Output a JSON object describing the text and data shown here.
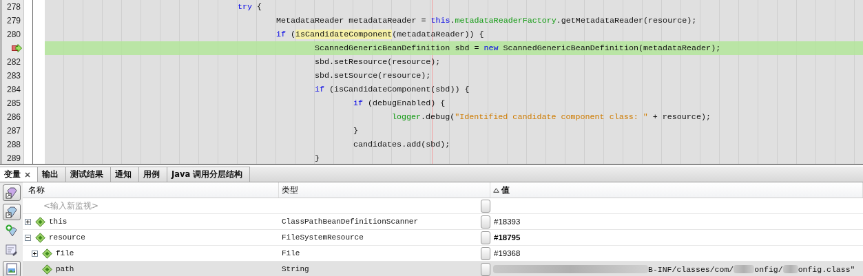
{
  "editor": {
    "lines": [
      {
        "number": "278",
        "current": false,
        "tokens": [
          {
            "kind": "keyword",
            "text": "try"
          },
          {
            "kind": "plain",
            "text": " {"
          }
        ],
        "children": [
          {
            "number": "279",
            "current": false,
            "tokens": [
              {
                "kind": "plain",
                "text": "MetadataReader metadataReader = "
              },
              {
                "kind": "keyword",
                "text": "this"
              },
              {
                "kind": "plain",
                "text": "."
              },
              {
                "kind": "field",
                "text": "metadataReaderFactory"
              },
              {
                "kind": "plain",
                "text": ".getMetadataReader(resource);"
              }
            ]
          },
          {
            "number": "280",
            "current": false,
            "tokens": [
              {
                "kind": "keyword",
                "text": "if"
              },
              {
                "kind": "plain",
                "text": " ("
              },
              {
                "kind": "mark",
                "text": "isCandidateComponent"
              },
              {
                "kind": "plain",
                "text": "(metadataReader)) {"
              }
            ],
            "children": [
              {
                "current": true,
                "tokens": [
                  {
                    "kind": "plain",
                    "text": "ScannedGenericBeanDefinition sbd = "
                  },
                  {
                    "kind": "keyword",
                    "text": "new"
                  },
                  {
                    "kind": "plain",
                    "text": " ScannedGenericBeanDefinition(metadataReader);"
                  }
                ]
              },
              {
                "number": "282",
                "current": false,
                "tokens": [
                  {
                    "kind": "plain",
                    "text": "sbd.setResource(resource);"
                  }
                ]
              },
              {
                "number": "283",
                "current": false,
                "tokens": [
                  {
                    "kind": "plain",
                    "text": "sbd.setSource(resource);"
                  }
                ]
              },
              {
                "number": "284",
                "current": false,
                "tokens": [
                  {
                    "kind": "keyword",
                    "text": "if"
                  },
                  {
                    "kind": "plain",
                    "text": " (isCandidateComponent(sbd)) {"
                  }
                ],
                "children": [
                  {
                    "number": "285",
                    "current": false,
                    "tokens": [
                      {
                        "kind": "keyword",
                        "text": "if"
                      },
                      {
                        "kind": "plain",
                        "text": " (debugEnabled) {"
                      }
                    ],
                    "children": [
                      {
                        "number": "286",
                        "current": false,
                        "tokens": [
                          {
                            "kind": "field",
                            "text": "logger"
                          },
                          {
                            "kind": "plain",
                            "text": ".debug("
                          },
                          {
                            "kind": "string",
                            "text": "\"Identified candidate component class: \""
                          },
                          {
                            "kind": "plain",
                            "text": " + resource);"
                          }
                        ]
                      }
                    ]
                  },
                  {
                    "number": "287",
                    "current": false,
                    "tokens": [
                      {
                        "kind": "plain",
                        "text": "}"
                      }
                    ]
                  },
                  {
                    "number": "288",
                    "current": false,
                    "tokens": [
                      {
                        "kind": "plain",
                        "text": "candidates.add(sbd);"
                      }
                    ]
                  }
                ]
              },
              {
                "number": "289",
                "current": false,
                "tokens": [
                  {
                    "kind": "plain",
                    "text": "}"
                  }
                ]
              }
            ]
          }
        ]
      }
    ]
  },
  "tabs": [
    {
      "label": "变量",
      "selected": true,
      "closable": true
    },
    {
      "label": "输出",
      "selected": false
    },
    {
      "label": "测试结果",
      "selected": false
    },
    {
      "label": "通知",
      "selected": false
    },
    {
      "label": "用例",
      "selected": false
    },
    {
      "label": "Java 调用分层结构",
      "selected": false
    }
  ],
  "toolbar": [
    {
      "kind": "gem",
      "on": true
    },
    {
      "kind": "gem2",
      "on": true
    },
    {
      "kind": "add",
      "on": false
    },
    {
      "kind": "tools",
      "on": false
    },
    {
      "kind": "picture",
      "on": true
    }
  ],
  "table": {
    "columns": [
      {
        "label": "名称"
      },
      {
        "label": "类型"
      },
      {
        "label": "值",
        "sorted": true
      }
    ],
    "watch_placeholder": "<输入新监视>",
    "rows": [
      {
        "name": "this",
        "type": "ClassPathBeanDefinitionScanner",
        "value": "#18393",
        "expanded": false,
        "changed": false,
        "selected": false
      },
      {
        "name": "resource",
        "type": "FileSystemResource",
        "value": "#18795",
        "expanded": true,
        "changed": true,
        "selected": false,
        "children": [
          {
            "name": "file",
            "type": "File",
            "value": "#19368",
            "expanded": false,
            "selected": false
          },
          {
            "name": "path",
            "type": "String",
            "value_segments": [
              "B-INF/classes/com/",
              "onfig/",
              "onfig.class\""
            ],
            "selected": true
          }
        ]
      }
    ]
  }
}
